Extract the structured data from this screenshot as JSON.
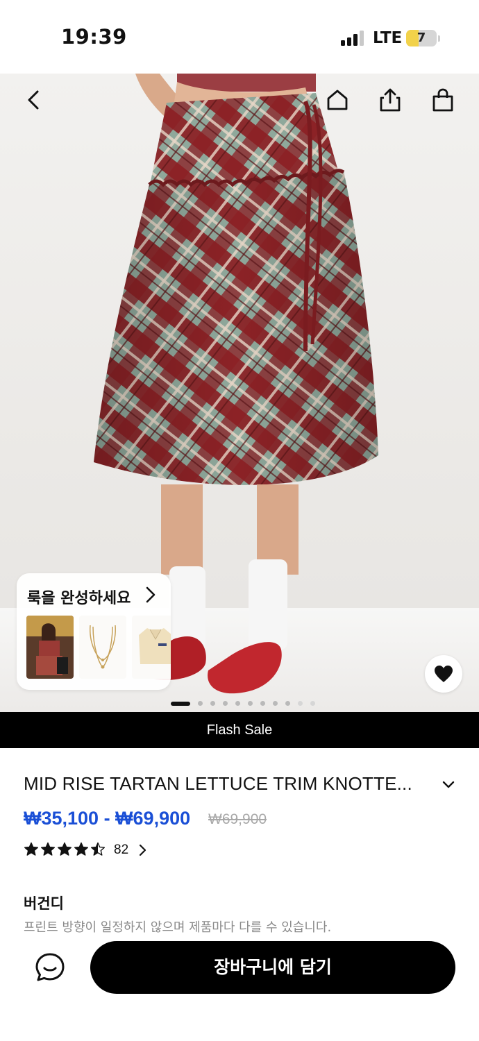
{
  "status_bar": {
    "time": "19:39",
    "network": "LTE",
    "battery": "7"
  },
  "nav": {
    "icons": [
      "back-icon",
      "home-icon",
      "share-icon",
      "shopping-bag-icon"
    ]
  },
  "look_card": {
    "title": "룩을 완성하세요",
    "thumbnails": [
      "model-outfit-thumbnail",
      "layered-necklace-thumbnail",
      "cream-sweater-thumbnail"
    ]
  },
  "gallery": {
    "total_images": 11,
    "current_image": 1
  },
  "flash_sale": {
    "label": "Flash Sale"
  },
  "product": {
    "title": "MID RISE TARTAN LETTUCE TRIM KNOTTE...",
    "price_range": "₩35,100 - ₩69,900",
    "original_price": "₩69,900",
    "rating": 4.5,
    "review_count": "82",
    "color": "버건디",
    "notice": "프린트 방향이 일정하지 않으며 제품마다 다를 수 있습니다."
  },
  "actions": {
    "add_to_cart": "장바구니에 담기"
  },
  "colors": {
    "price": "#1a4fd6",
    "flash_bar": "#000000",
    "skirt_burgundy": "#8c1f24",
    "skirt_sage": "#8fa89b"
  }
}
